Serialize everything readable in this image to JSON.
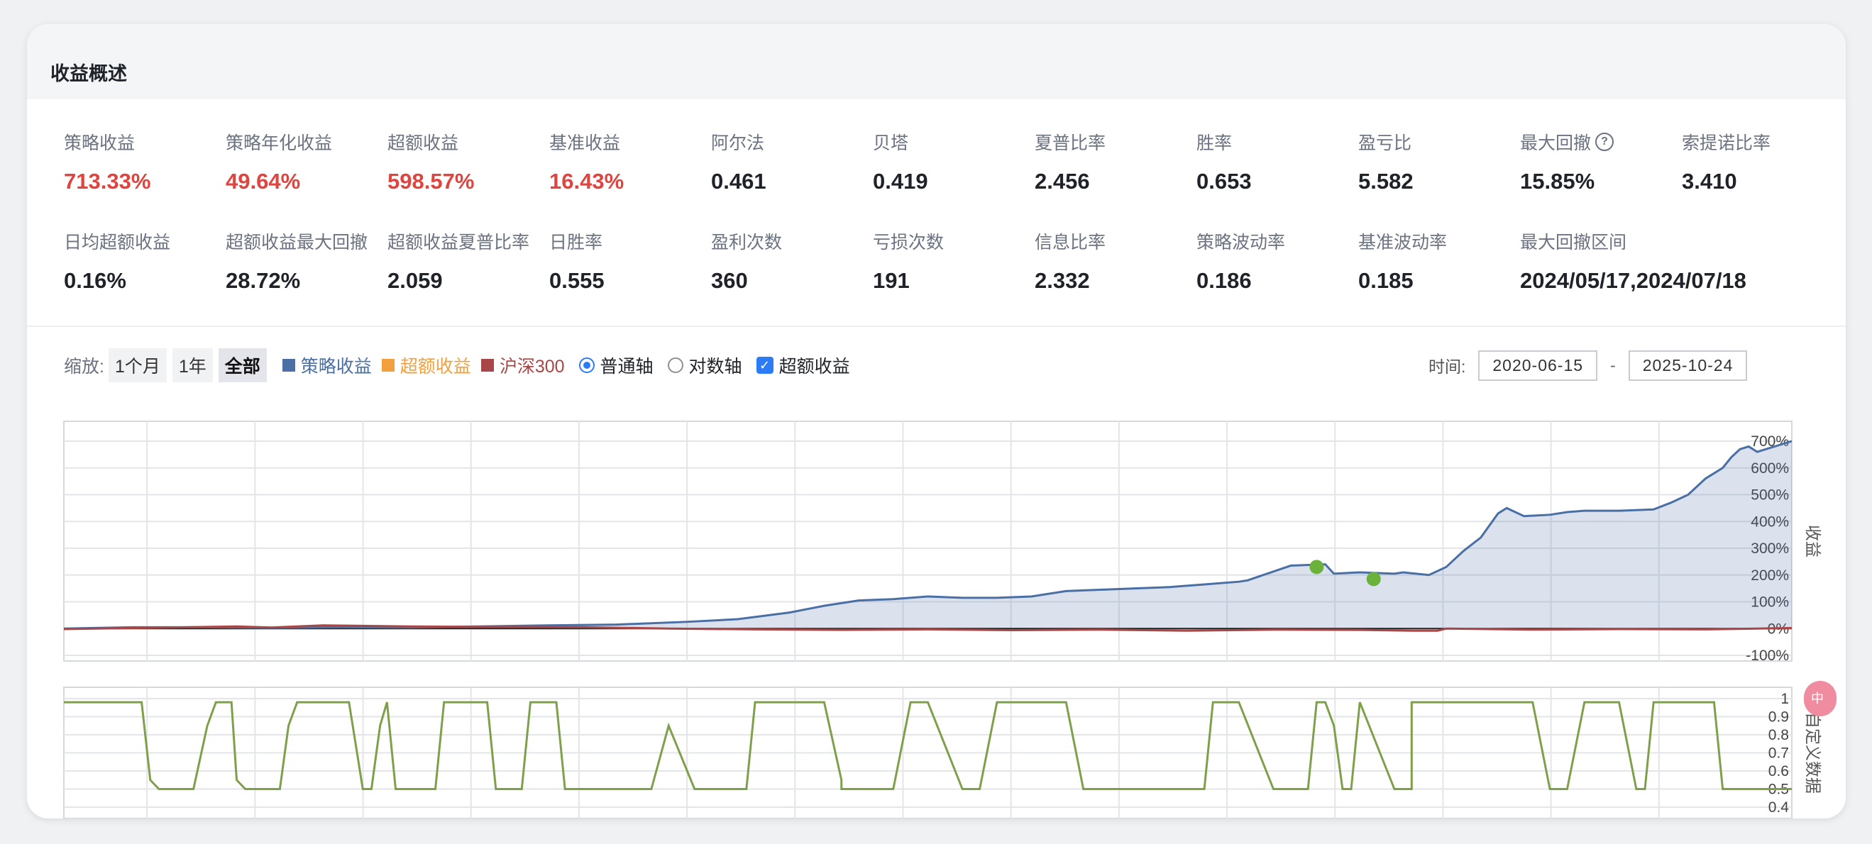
{
  "section": {
    "title": "收益概述"
  },
  "metrics_row1": [
    {
      "label": "策略收益",
      "value": "713.33%",
      "red": true
    },
    {
      "label": "策略年化收益",
      "value": "49.64%",
      "red": true
    },
    {
      "label": "超额收益",
      "value": "598.57%",
      "red": true
    },
    {
      "label": "基准收益",
      "value": "16.43%",
      "red": true
    },
    {
      "label": "阿尔法",
      "value": "0.461"
    },
    {
      "label": "贝塔",
      "value": "0.419"
    },
    {
      "label": "夏普比率",
      "value": "2.456"
    },
    {
      "label": "胜率",
      "value": "0.653"
    },
    {
      "label": "盈亏比",
      "value": "5.582"
    },
    {
      "label": "最大回撤",
      "value": "15.85%",
      "help": true
    },
    {
      "label": "索提诺比率",
      "value": "3.410"
    }
  ],
  "metrics_row2": [
    {
      "label": "日均超额收益",
      "value": "0.16%"
    },
    {
      "label": "超额收益最大回撤",
      "value": "28.72%"
    },
    {
      "label": "超额收益夏普比率",
      "value": "2.059"
    },
    {
      "label": "日胜率",
      "value": "0.555"
    },
    {
      "label": "盈利次数",
      "value": "360"
    },
    {
      "label": "亏损次数",
      "value": "191"
    },
    {
      "label": "信息比率",
      "value": "2.332"
    },
    {
      "label": "策略波动率",
      "value": "0.186"
    },
    {
      "label": "基准波动率",
      "value": "0.185"
    },
    {
      "label": "最大回撤区间",
      "value": "2024/05/17,2024/07/18"
    }
  ],
  "toolbar": {
    "zoom_label": "缩放:",
    "zoom_1m": "1个月",
    "zoom_1y": "1年",
    "zoom_all": "全部",
    "legend_strategy": "策略收益",
    "legend_excess": "超额收益",
    "legend_benchmark": "沪深300",
    "radio_normal": "普通轴",
    "radio_log": "对数轴",
    "checkbox_excess": "超额收益",
    "time_label": "时间:",
    "date_start": "2020-06-15",
    "date_end": "2025-10-24",
    "date_sep": "-"
  },
  "side_badge": "中",
  "colors": {
    "strategy": "#4a6fa5",
    "excess": "#f2a03d",
    "benchmark": "#a84747",
    "custom": "#7ea04a",
    "red_value": "#e0443e",
    "marker": "#6ab23c"
  },
  "chart_data": [
    {
      "type": "area",
      "ylabel": "收益",
      "y_ticks": [
        "700%",
        "600%",
        "500%",
        "400%",
        "300%",
        "200%",
        "100%",
        "0%",
        "-100%"
      ],
      "ylim": [
        -100,
        720
      ],
      "x_range": [
        "2020-06-15",
        "2025-10-24"
      ],
      "grid": true,
      "series": [
        {
          "name": "策略收益",
          "x": [
            0.0,
            0.04,
            0.08,
            0.12,
            0.16,
            0.2,
            0.24,
            0.28,
            0.32,
            0.36,
            0.39,
            0.42,
            0.44,
            0.46,
            0.48,
            0.5,
            0.52,
            0.54,
            0.56,
            0.58,
            0.6,
            0.62,
            0.64,
            0.66,
            0.68,
            0.685,
            0.71,
            0.73,
            0.735,
            0.75,
            0.77,
            0.775,
            0.79,
            0.8,
            0.81,
            0.82,
            0.83,
            0.835,
            0.845,
            0.86,
            0.87,
            0.88,
            0.9,
            0.92,
            0.93,
            0.94,
            0.95,
            0.96,
            0.965,
            0.97,
            0.975,
            0.98,
            0.99,
            1.0
          ],
          "values": [
            0,
            5,
            5,
            3,
            5,
            4,
            8,
            12,
            15,
            25,
            35,
            60,
            85,
            105,
            110,
            120,
            115,
            115,
            120,
            140,
            145,
            150,
            155,
            165,
            175,
            180,
            235,
            240,
            205,
            210,
            205,
            210,
            200,
            230,
            290,
            340,
            430,
            450,
            420,
            425,
            435,
            440,
            440,
            445,
            470,
            500,
            560,
            600,
            640,
            670,
            680,
            660,
            680,
            700
          ]
        },
        {
          "name": "沪深300",
          "x": [
            0.0,
            0.05,
            0.1,
            0.12,
            0.15,
            0.2,
            0.25,
            0.3,
            0.35,
            0.4,
            0.45,
            0.5,
            0.55,
            0.6,
            0.65,
            0.7,
            0.75,
            0.78,
            0.795,
            0.8,
            0.85,
            0.9,
            0.95,
            1.0
          ],
          "values": [
            -2,
            3,
            8,
            4,
            12,
            8,
            6,
            5,
            0,
            -3,
            -5,
            -3,
            -6,
            -4,
            -8,
            -4,
            -5,
            -8,
            -8,
            0,
            -4,
            -2,
            -3,
            2
          ]
        }
      ],
      "markers": [
        {
          "x": 0.725,
          "y": 230
        },
        {
          "x": 0.758,
          "y": 185
        }
      ]
    },
    {
      "type": "line",
      "ylabel": "自定义数据",
      "y_ticks": [
        "1",
        "0.9",
        "0.8",
        "0.7",
        "0.6",
        "0.5",
        "0.4"
      ],
      "ylim": [
        0.4,
        1.0
      ],
      "series": [
        {
          "name": "自定义数据",
          "x": [
            0.0,
            0.045,
            0.05,
            0.055,
            0.075,
            0.083,
            0.088,
            0.097,
            0.1,
            0.105,
            0.125,
            0.13,
            0.135,
            0.145,
            0.165,
            0.173,
            0.178,
            0.183,
            0.187,
            0.192,
            0.21,
            0.215,
            0.22,
            0.24,
            0.245,
            0.25,
            0.262,
            0.265,
            0.27,
            0.285,
            0.29,
            0.295,
            0.3,
            0.31,
            0.34,
            0.35,
            0.365,
            0.37,
            0.385,
            0.39,
            0.395,
            0.4,
            0.44,
            0.45,
            0.45,
            0.48,
            0.49,
            0.495,
            0.5,
            0.52,
            0.53,
            0.54,
            0.57,
            0.58,
            0.59,
            0.595,
            0.6,
            0.63,
            0.64,
            0.66,
            0.665,
            0.67,
            0.68,
            0.7,
            0.71,
            0.72,
            0.725,
            0.73,
            0.735,
            0.74,
            0.745,
            0.75,
            0.77,
            0.775,
            0.78,
            0.78,
            0.83,
            0.84,
            0.85,
            0.86,
            0.87,
            0.88,
            0.9,
            0.91,
            0.915,
            0.92,
            0.94,
            0.95,
            0.955,
            0.96,
            0.97,
            1.0
          ],
          "values": [
            0.98,
            0.98,
            0.55,
            0.5,
            0.5,
            0.85,
            0.98,
            0.98,
            0.55,
            0.5,
            0.5,
            0.85,
            0.98,
            0.98,
            0.98,
            0.5,
            0.5,
            0.85,
            0.98,
            0.5,
            0.5,
            0.5,
            0.98,
            0.98,
            0.98,
            0.5,
            0.5,
            0.5,
            0.98,
            0.98,
            0.5,
            0.5,
            0.5,
            0.5,
            0.5,
            0.85,
            0.5,
            0.5,
            0.5,
            0.5,
            0.5,
            0.98,
            0.98,
            0.55,
            0.5,
            0.5,
            0.98,
            0.98,
            0.98,
            0.5,
            0.5,
            0.98,
            0.98,
            0.98,
            0.5,
            0.5,
            0.5,
            0.5,
            0.5,
            0.5,
            0.98,
            0.98,
            0.98,
            0.5,
            0.5,
            0.5,
            0.98,
            0.98,
            0.85,
            0.5,
            0.5,
            0.98,
            0.5,
            0.5,
            0.5,
            0.98,
            0.98,
            0.98,
            0.98,
            0.5,
            0.5,
            0.98,
            0.98,
            0.5,
            0.5,
            0.98,
            0.98,
            0.98,
            0.98,
            0.5,
            0.5,
            0.5
          ]
        }
      ]
    }
  ]
}
